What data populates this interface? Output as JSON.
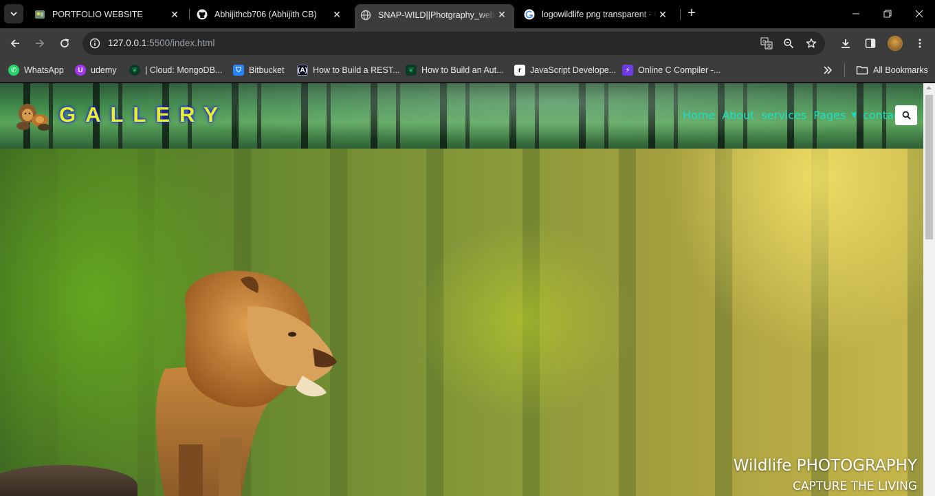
{
  "browser": {
    "tabs": [
      {
        "title": "PORTFOLIO WEBSITE",
        "icon": "portfolio-favicon"
      },
      {
        "title": "Abhijithcb706 (Abhijith CB)",
        "icon": "github-icon"
      },
      {
        "title": "SNAP-WILD||Photgraphy_website",
        "icon": "globe-icon",
        "active": true
      },
      {
        "title": "logowildlife png transparent - Google Search",
        "icon": "google-icon"
      }
    ],
    "address": {
      "host": "127.0.0.1",
      "rest": ":5500/index.html"
    },
    "bookmarks": [
      {
        "label": "WhatsApp",
        "icon": "whatsapp-icon",
        "color": "#25d366"
      },
      {
        "label": "udemy",
        "icon": "udemy-icon",
        "color": "#a435f0"
      },
      {
        "label": "| Cloud: MongoDB...",
        "icon": "mongodb-icon",
        "color": "#13aa52"
      },
      {
        "label": "Bitbucket",
        "icon": "bitbucket-icon",
        "color": "#2684ff"
      },
      {
        "label": "How to Build a REST...",
        "icon": "freecodecamp-icon",
        "color": "#0a0a23"
      },
      {
        "label": "How to Build an Aut...",
        "icon": "mongodb-icon",
        "color": "#13aa52"
      },
      {
        "label": "JavaScript Develope...",
        "icon": "replit-icon",
        "color": "#111111"
      },
      {
        "label": "Online C Compiler -...",
        "icon": "programiz-icon",
        "color": "#6c3be4"
      }
    ],
    "all_bookmarks": "All Bookmarks"
  },
  "site": {
    "brand": "GALLERY",
    "nav": [
      "Home",
      "About",
      "services",
      "Pages",
      "contact"
    ],
    "hero_title": "Wildlife PHOTOGRAPHY",
    "hero_subtitle": "CAPTURE THE LIVING"
  },
  "colors": {
    "brand_text": "#e9f226",
    "nav_text": "#19e0c8",
    "chrome_bg": "#3c3c3c"
  }
}
